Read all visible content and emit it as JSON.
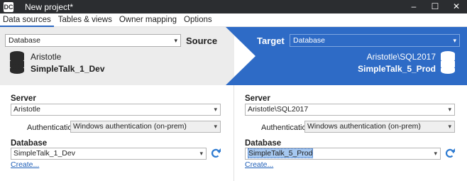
{
  "window": {
    "title": "New project*",
    "app_icon": "DC",
    "controls": {
      "minimize": "–",
      "maximize": "☐",
      "close": "✕"
    }
  },
  "menu": {
    "items": [
      "Data sources",
      "Tables & views",
      "Owner mapping",
      "Options"
    ],
    "active_index": 0
  },
  "source": {
    "type_select": "Database",
    "label": "Source",
    "server": "Aristotle",
    "database": "SimpleTalk_1_Dev"
  },
  "target": {
    "type_select": "Database",
    "label": "Target",
    "server": "Aristotle\\SQL2017",
    "database": "SimpleTalk_5_Prod"
  },
  "source_panel": {
    "server_label": "Server",
    "server_value": "Aristotle",
    "auth_label": "Authentication",
    "auth_value": "Windows authentication (on-prem)",
    "database_label": "Database",
    "database_value": "SimpleTalk_1_Dev",
    "create_link": "Create..."
  },
  "target_panel": {
    "server_label": "Server",
    "server_value": "Aristotle\\SQL2017",
    "auth_label": "Authentication",
    "auth_value": "Windows authentication (on-prem)",
    "database_label": "Database",
    "database_value": "SimpleTalk_5_Prod",
    "create_link": "Create..."
  },
  "colors": {
    "titlebar": "#2b2d30",
    "source_band": "#ececec",
    "target_band": "#2e6bc6",
    "link": "#1f5fb8",
    "refresh": "#2e7bd1"
  },
  "icons": {
    "dropdown": "▾",
    "database": "database-icon",
    "refresh": "refresh-icon"
  }
}
